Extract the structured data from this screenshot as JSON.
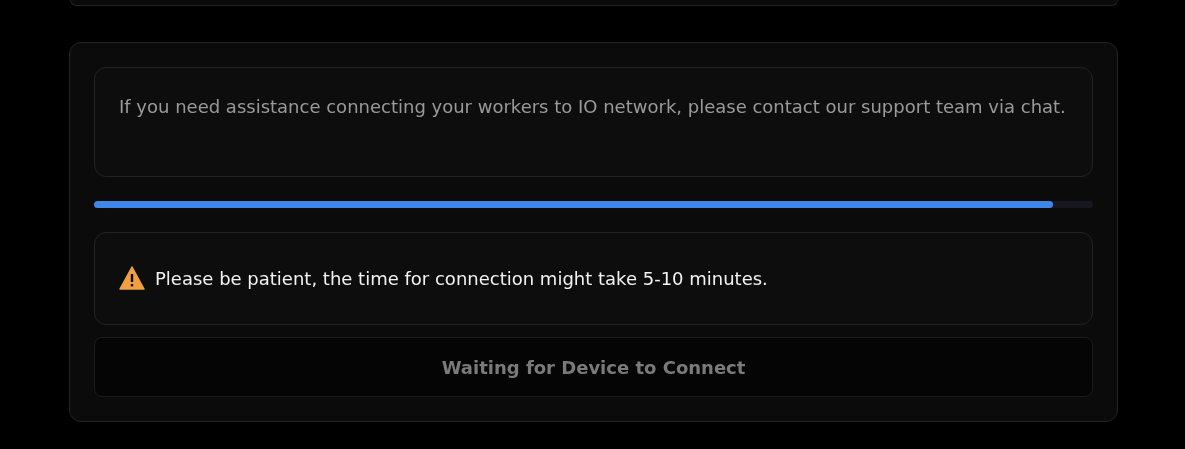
{
  "info": {
    "text": "If you need assistance connecting your workers to IO network, please contact our support team via chat."
  },
  "progress": {
    "level": 0.96
  },
  "notice": {
    "text": "Please be patient, the time for connection might take 5-10 minutes."
  },
  "button": {
    "label": "Waiting for Device to Connect",
    "disabled": true
  }
}
